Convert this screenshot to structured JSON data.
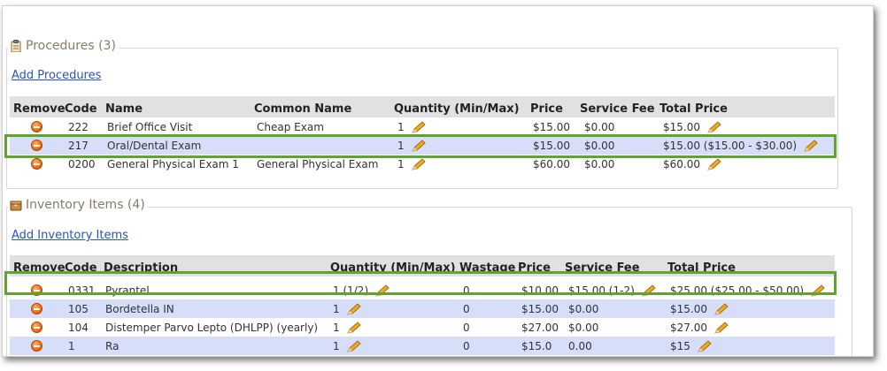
{
  "procedures": {
    "title": "Procedures (3)",
    "add_link": "Add Procedures",
    "headers": {
      "remove": "Remove",
      "code": "Code",
      "name": "Name",
      "common": "Common Name",
      "quantity": "Quantity (Min/Max)",
      "price": "Price",
      "fee": "Service Fee",
      "total": "Total Price"
    },
    "rows": [
      {
        "code": "222",
        "name": "Brief Office Visit",
        "common": "Cheap Exam",
        "quantity": "1",
        "price": "$15.00",
        "fee": "$0.00",
        "total": "$15.00"
      },
      {
        "code": "217",
        "name": "Oral/Dental Exam",
        "common": "",
        "quantity": "1",
        "price": "$15.00",
        "fee": "$0.00",
        "total": "$15.00 ($15.00 - $30.00)"
      },
      {
        "code": "0200",
        "name": "General Physical Exam 1",
        "common": "General Physical Exam",
        "quantity": "1",
        "price": "$60.00",
        "fee": "$0.00",
        "total": "$60.00"
      }
    ]
  },
  "inventory": {
    "title": "Inventory Items (4)",
    "add_link": "Add Inventory Items",
    "headers": {
      "remove": "Remove",
      "code": "Code",
      "description": "Description",
      "quantity": "Quantity (Min/Max)",
      "wastage": "Wastage",
      "price": "Price",
      "fee": "Service Fee",
      "total": "Total Price"
    },
    "rows": [
      {
        "code": "0331",
        "description": "Pyrantel",
        "quantity": "1 (1/2)",
        "wastage": "0",
        "price": "$10.00",
        "fee": "$15.00 (1-2)",
        "total": "$25.00 ($25.00 - $50.00)"
      },
      {
        "code": "105",
        "description": "Bordetella IN",
        "quantity": "1",
        "wastage": "0",
        "price": "$15.00",
        "fee": "$0.00",
        "total": "$15.00"
      },
      {
        "code": "104",
        "description": "Distemper Parvo Lepto (DHLPP) (yearly)",
        "quantity": "1",
        "wastage": "0",
        "price": "$27.00",
        "fee": "$0.00",
        "total": "$27.00"
      },
      {
        "code": "1",
        "description": "Ra",
        "quantity": "1",
        "wastage": "0",
        "price": "$15.0",
        "fee": "0.00",
        "total": "$15"
      }
    ]
  },
  "colors": {
    "highlight": "#62a22f",
    "link": "#2455b8",
    "alt_row": "#d6defa",
    "header_bg": "#e1e1e1"
  }
}
